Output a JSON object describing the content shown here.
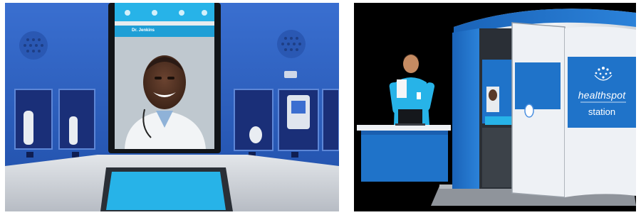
{
  "left_photo": {
    "screen_header": "Dr. Jenkins",
    "colors": {
      "wall": "#2c60c2",
      "counter": "#d9dde3",
      "screen_blue": "#27b3e8"
    }
  },
  "right_photo": {
    "brand": "healthspot",
    "brand_sub": "station",
    "colors": {
      "booth_blue": "#1f73c9",
      "booth_white": "#eef1f5",
      "background": "#000000"
    }
  }
}
